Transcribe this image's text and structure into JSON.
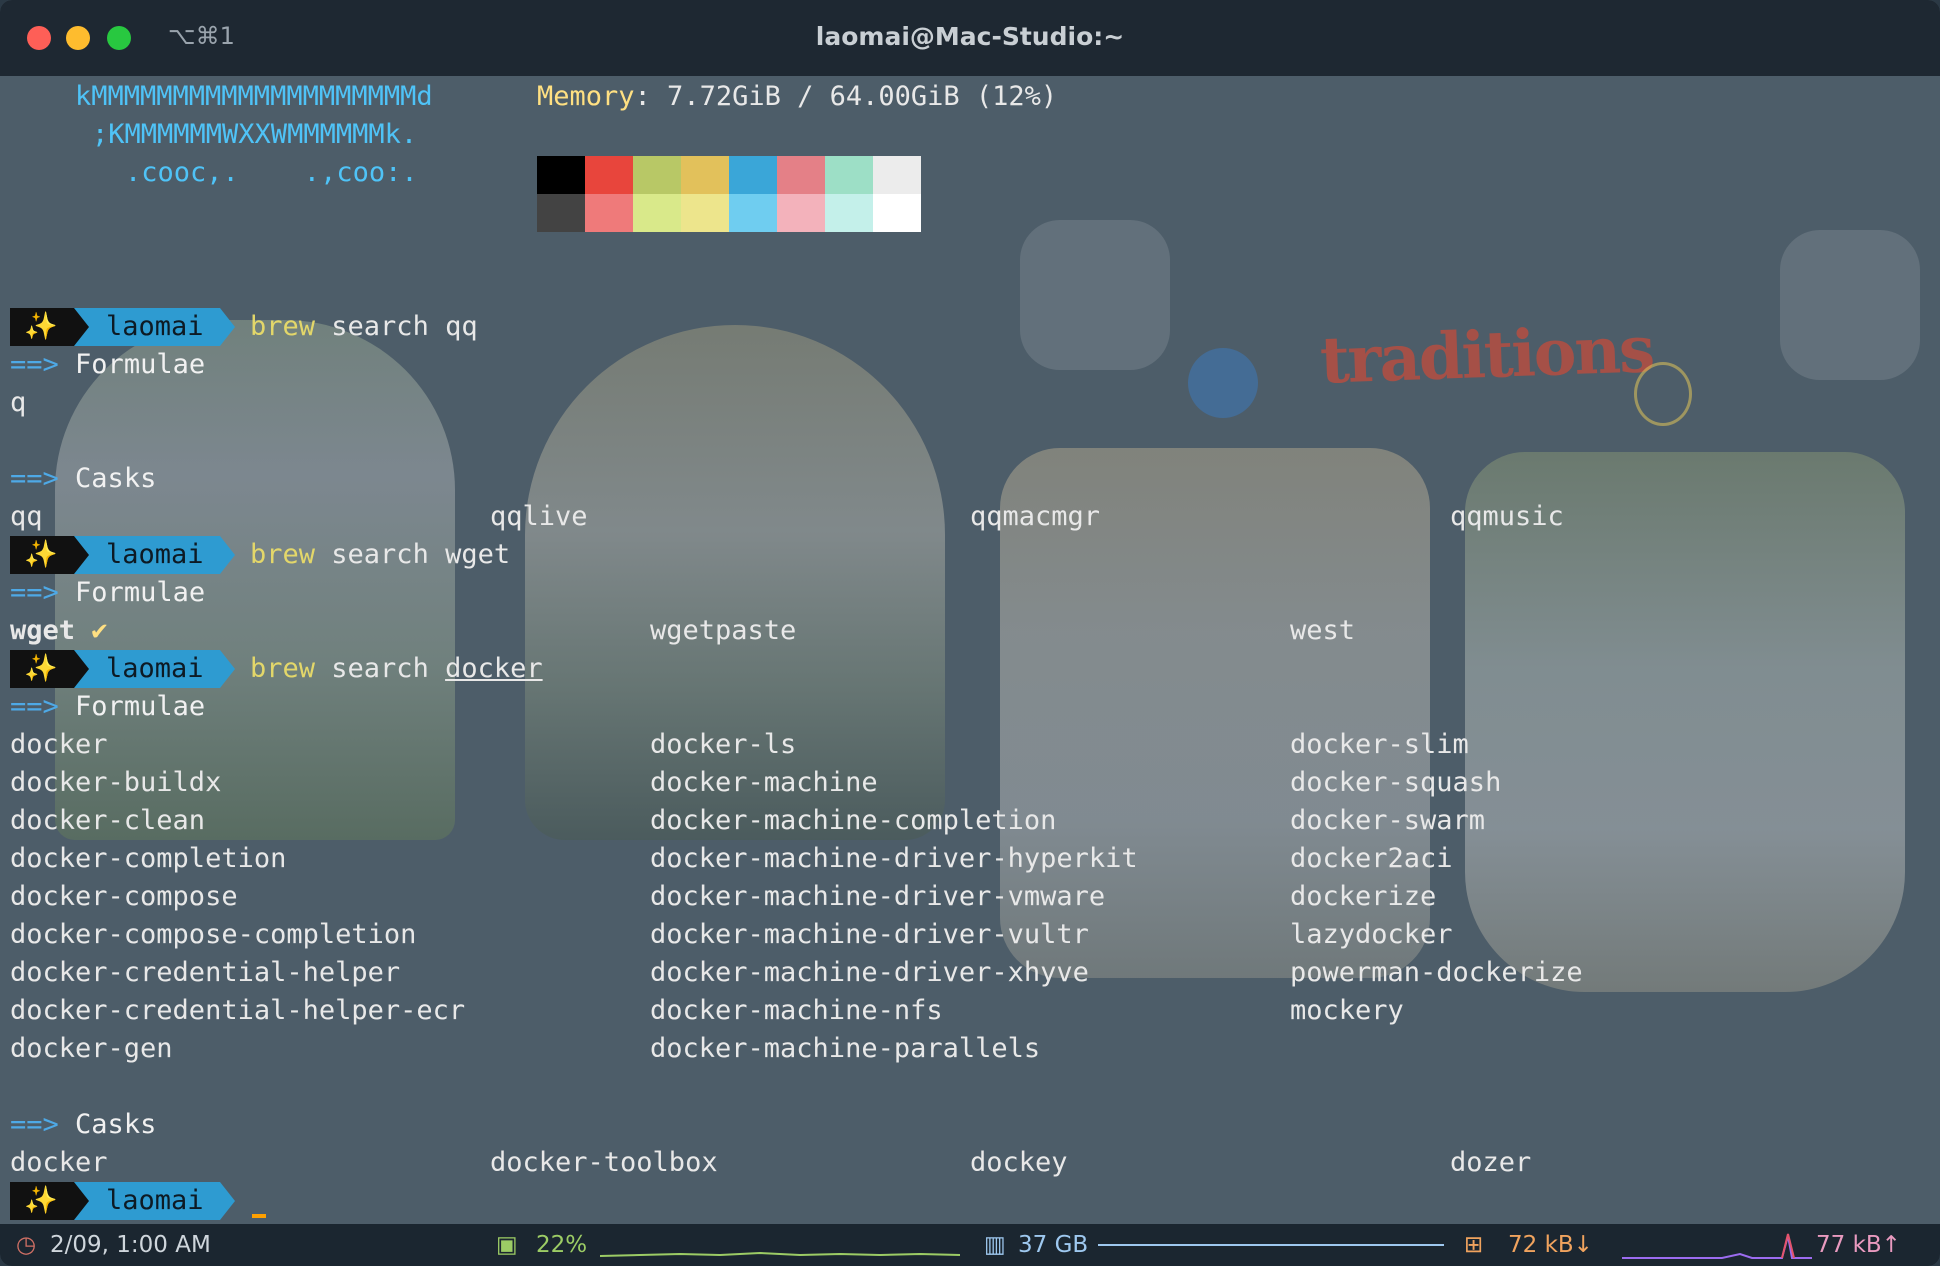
{
  "window": {
    "title": "laomai@Mac-Studio:~",
    "shortcut": "⌥⌘1"
  },
  "neofetch": {
    "ascii": [
      "kMMMMMMMMMMMMMMMMMMMMd",
      ";KMMMMMMWXXWMMMMMMk.",
      ".cooc,.    .,coo:."
    ],
    "memory_label": "Memory",
    "memory_value": ": 7.72GiB / 64.00GiB (12%)",
    "palette_top": [
      "#000000",
      "#e8453c",
      "#b8c866",
      "#e2c15b",
      "#3aa6d8",
      "#e48087",
      "#9ddfc6",
      "#ececec"
    ],
    "palette_bottom": [
      "#434343",
      "#ef7a7a",
      "#d9e98a",
      "#ede58c",
      "#6fcdf0",
      "#f3b2bb",
      "#c4f0ea",
      "#ffffff"
    ]
  },
  "prompt": {
    "icon": "✨",
    "user": "laomai"
  },
  "session": {
    "cmd1": {
      "tool": "brew",
      "rest": " search qq"
    },
    "arrow": "==>",
    "formulae": "Formulae",
    "casks": "Casks",
    "qq_formulae": [
      "q"
    ],
    "qq_casks": [
      "qq",
      "qqlive",
      "qqmacmgr",
      "qqmusic"
    ],
    "cmd2": {
      "tool": "brew",
      "rest": " search wget"
    },
    "wget_formulae": [
      "wget",
      "wgetpaste",
      "west"
    ],
    "check": "✔",
    "cmd3": {
      "tool": "brew",
      "rest_a": " search ",
      "rest_b": "docker"
    },
    "docker_col1": [
      "docker",
      "docker-buildx",
      "docker-clean",
      "docker-completion",
      "docker-compose",
      "docker-compose-completion",
      "docker-credential-helper",
      "docker-credential-helper-ecr",
      "docker-gen"
    ],
    "docker_col2": [
      "docker-ls",
      "docker-machine",
      "docker-machine-completion",
      "docker-machine-driver-hyperkit",
      "docker-machine-driver-vmware",
      "docker-machine-driver-vultr",
      "docker-machine-driver-xhyve",
      "docker-machine-nfs",
      "docker-machine-parallels"
    ],
    "docker_col3": [
      "docker-slim",
      "docker-squash",
      "docker-swarm",
      "docker2aci",
      "dockerize",
      "lazydocker",
      "powerman-dockerize",
      "mockery"
    ],
    "docker_casks": [
      "docker",
      "docker-toolbox",
      "dockey",
      "dozer"
    ]
  },
  "background": {
    "logo": "traditions"
  },
  "statusbar": {
    "datetime": "2/09, 1:00 AM",
    "cpu": "22%",
    "memory": "37 GB",
    "download": "72 kB↓",
    "upload": "77 kB↑"
  }
}
